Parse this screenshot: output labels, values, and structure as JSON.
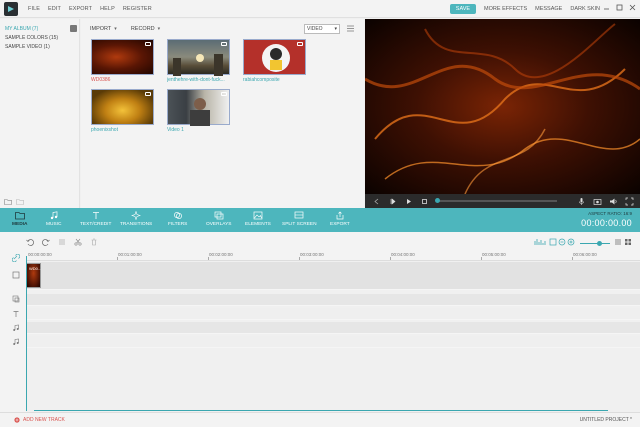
{
  "menu": {
    "items": [
      "FILE",
      "EDIT",
      "EXPORT",
      "HELP",
      "REGISTER"
    ],
    "save": "SAVE",
    "more_effects": "MORE EFFECTS",
    "message": "MESSAGE",
    "dark_skin": "DARK SKIN"
  },
  "albums": [
    {
      "label": "MY ALBUM (7)",
      "active": true
    },
    {
      "label": "SAMPLE COLORS (15)",
      "active": false
    },
    {
      "label": "SAMPLE VIDEO (1)",
      "active": false
    }
  ],
  "library": {
    "import": "IMPORT",
    "record": "RECORD",
    "filter": "VIDEO",
    "items": [
      {
        "name": "WD0386",
        "color": "#d9534f"
      },
      {
        "name": "jenthehre-with-dont-fuck...",
        "color": "#3aa7b0"
      },
      {
        "name": "rabiahcomposite",
        "color": "#3aa7b0"
      },
      {
        "name": "phoenixshot",
        "color": "#3aa7b0"
      },
      {
        "name": "Video 1",
        "color": "#3aa7b0"
      }
    ]
  },
  "tools": [
    {
      "label": "MEDIA",
      "icon": "folder-icon"
    },
    {
      "label": "MUSIC",
      "icon": "music-note-icon"
    },
    {
      "label": "TEXT/CREDIT",
      "icon": "text-icon"
    },
    {
      "label": "TRANSITIONS",
      "icon": "transitions-icon"
    },
    {
      "label": "FILTERS",
      "icon": "filters-icon"
    },
    {
      "label": "OVERLAYS",
      "icon": "overlays-icon"
    },
    {
      "label": "ELEMENTS",
      "icon": "elements-icon"
    },
    {
      "label": "SPLIT SCREEN",
      "icon": "split-screen-icon"
    },
    {
      "label": "EXPORT",
      "icon": "export-icon"
    }
  ],
  "aspect_ratio": "ASPECT RATIO: 16:9",
  "timecode": "00:00:00.00",
  "ruler": [
    "00:00:00:00",
    "00:01:00:00",
    "00:02:00:00",
    "00:03:00:00",
    "00:04:00:00",
    "00:05:00:00",
    "00:06:00:00"
  ],
  "clip_label": "WD0...",
  "bottom": {
    "add_track": "ADD NEW TRACK",
    "project": "UNTITLED PROJECT *"
  },
  "colors": {
    "accent": "#4db6bd",
    "accent_dark": "#3aa7b0",
    "warning": "#d9534f"
  },
  "playback_progress": 0.0
}
